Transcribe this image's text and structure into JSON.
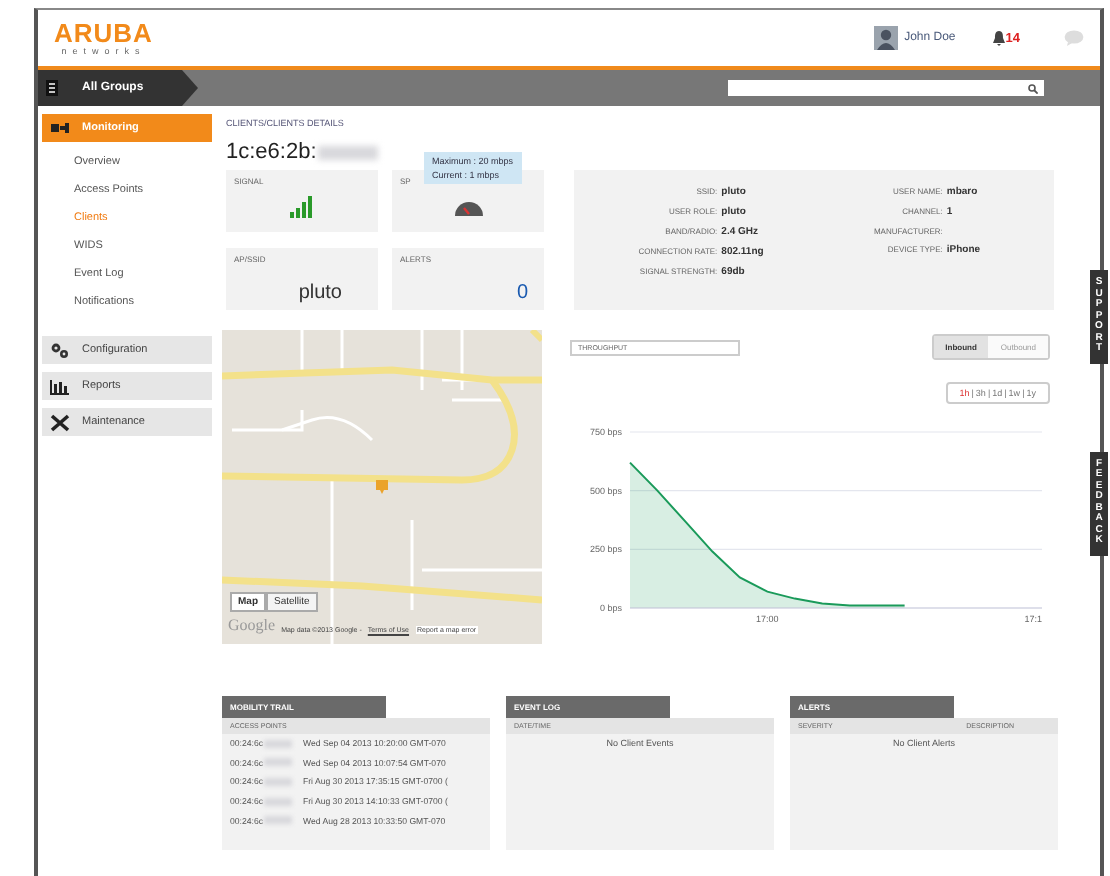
{
  "header": {
    "logo": "ARUBA",
    "logo_sub": "networks",
    "user": "John Doe",
    "alert_count": "14"
  },
  "group_bar": {
    "group": "All Groups"
  },
  "sidebar": {
    "sections": [
      {
        "label": "Monitoring",
        "expanded": true,
        "children": [
          {
            "label": "Overview",
            "selected": false
          },
          {
            "label": "Access Points",
            "selected": false
          },
          {
            "label": "Clients",
            "selected": true
          },
          {
            "label": "WIDS",
            "selected": false
          },
          {
            "label": "Event Log",
            "selected": false
          },
          {
            "label": "Notifications",
            "selected": false
          }
        ]
      },
      {
        "label": "Configuration",
        "expanded": false
      },
      {
        "label": "Reports",
        "expanded": false
      },
      {
        "label": "Maintenance",
        "expanded": false
      }
    ]
  },
  "breadcrumb": "CLIENTS/CLIENTS DETAILS",
  "client_mac": "1c:e6:2b:",
  "tiles": [
    {
      "kind": "signal",
      "label": "SIGNAL"
    },
    {
      "kind": "speed",
      "label": "SP"
    },
    {
      "kind": "text",
      "label": "AP/SSID",
      "value": "pluto"
    },
    {
      "kind": "count",
      "label": "ALERTS",
      "value": "0"
    }
  ],
  "speed_tooltip": [
    "Maximum : 20 mbps",
    "Current : 1 mbps"
  ],
  "details": {
    "left": [
      {
        "label": "SSID:",
        "value": "pluto"
      },
      {
        "label": "USER ROLE:",
        "value": "pluto"
      },
      {
        "label": "BAND/RADIO:",
        "value": "2.4 GHz"
      },
      {
        "label": "CONNECTION RATE:",
        "value": "802.11ng"
      },
      {
        "label": "SIGNAL STRENGTH:",
        "value": "69db"
      }
    ],
    "right": [
      {
        "label": "USER NAME:",
        "value": "mbaro"
      },
      {
        "label": "CHANNEL:",
        "value": "1"
      },
      {
        "label": "MANUFACTURER:"
      },
      {
        "label": "DEVICE TYPE:",
        "value": "iPhone"
      }
    ]
  },
  "map": {
    "buttons": [
      {
        "label": "Map",
        "selected": true
      },
      {
        "label": "Satellite",
        "selected": false
      }
    ],
    "logo": "Google",
    "attribution": "Map data ©2013 Google -",
    "terms": "Terms of Use",
    "report": "Report a map error"
  },
  "throughput": {
    "label": "THROUGHPUT",
    "directions": [
      {
        "label": "Inbound",
        "selected": true
      },
      {
        "label": "Outbound",
        "selected": false
      }
    ],
    "separator": "|",
    "ranges": [
      {
        "label": "1h",
        "selected": true
      },
      {
        "label": "3h",
        "selected": false
      },
      {
        "label": "1d",
        "selected": false
      },
      {
        "label": "1w",
        "selected": false
      },
      {
        "label": "1y",
        "selected": false
      }
    ],
    "chart_data": {
      "type": "area",
      "categories": [
        null,
        null,
        null,
        null,
        null,
        "17:00",
        null,
        null,
        null,
        null,
        null,
        null,
        null,
        null,
        null,
        "17:1"
      ],
      "series": [
        {
          "color": "#1a9a5a",
          "values": [
            620,
            500,
            370,
            240,
            130,
            70,
            40,
            20,
            10,
            10,
            10,
            null,
            null,
            null,
            null,
            null
          ]
        }
      ],
      "ylim": [
        0,
        750
      ],
      "yticks": [
        {
          "value": 0,
          "label": "0 bps"
        },
        {
          "value": 250,
          "label": "250 bps"
        },
        {
          "value": 500,
          "label": "500 bps"
        },
        {
          "value": 750,
          "label": "750 bps"
        }
      ]
    }
  },
  "side_tabs": [
    {
      "label": "SUPPORT"
    },
    {
      "label": "FEEDBACK"
    }
  ],
  "panels": [
    {
      "kind": "trail",
      "title": "MOBILITY TRAIL",
      "columns": [
        "ACCESS POINTS"
      ],
      "rows": [
        {
          "ap": "00:24:6c",
          "time": "Wed Sep 04 2013 10:20:00 GMT-070"
        },
        {
          "ap": "00:24:6c",
          "time": "Wed Sep 04 2013 10:07:54 GMT-070"
        },
        {
          "ap": "00:24:6c",
          "time": "Fri Aug 30 2013 17:35:15 GMT-0700 ("
        },
        {
          "ap": "00:24:6c",
          "time": "Fri Aug 30 2013 14:10:33 GMT-0700 ("
        },
        {
          "ap": "00:24:6c",
          "time": "Wed Aug 28 2013 10:33:50 GMT-070"
        }
      ]
    },
    {
      "kind": "empty",
      "title": "EVENT LOG",
      "columns": [
        "DATE/TIME"
      ],
      "empty": "No Client Events"
    },
    {
      "kind": "empty",
      "title": "ALERTS",
      "columns": [
        "SEVERITY",
        "DESCRIPTION"
      ],
      "empty": "No Client Alerts"
    }
  ]
}
